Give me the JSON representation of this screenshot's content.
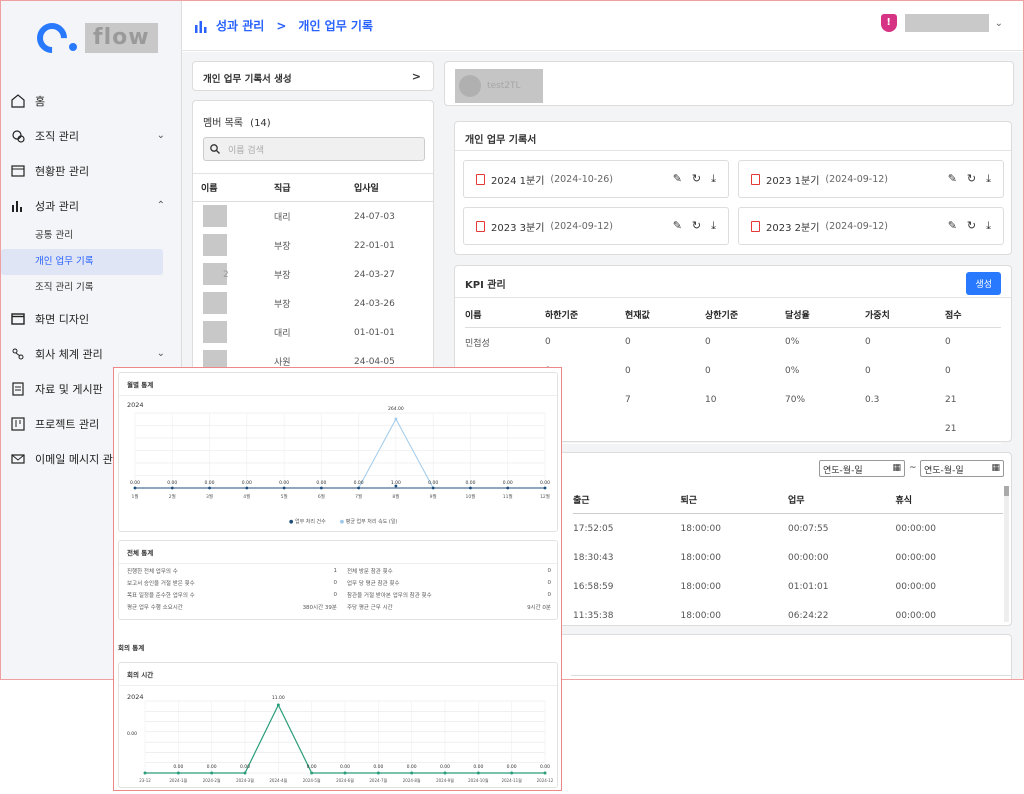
{
  "app": {
    "logo_text": "flow"
  },
  "sidebar": {
    "items": [
      {
        "label": "홈",
        "icon": "home-icon",
        "chevron": ""
      },
      {
        "label": "조직 관리",
        "icon": "org-icon",
        "chevron": "⌄"
      },
      {
        "label": "현황판 관리",
        "icon": "dashboard-icon",
        "chevron": ""
      },
      {
        "label": "성과 관리",
        "icon": "chart-icon",
        "chevron": "⌃"
      }
    ],
    "sub_items": [
      "공통 관리",
      "개인 업무 기록",
      "조직 관리 기록"
    ],
    "items2": [
      {
        "label": "화면 디자인",
        "icon": "window-icon",
        "chevron": ""
      },
      {
        "label": "회사 체계 관리",
        "icon": "hierarchy-icon",
        "chevron": "⌄"
      },
      {
        "label": "자료 및 게시판",
        "icon": "board-icon",
        "chevron": ""
      },
      {
        "label": "프로젝트 관리",
        "icon": "kanban-icon",
        "chevron": ""
      },
      {
        "label": "이메일 메시지 관리",
        "icon": "mail-icon",
        "chevron": ""
      }
    ]
  },
  "topbar": {
    "crumb1": "성과 관리",
    "sep": ">",
    "crumb2": "개인 업무 기록"
  },
  "left_panel": {
    "create_label": "개인 업무 기록서 생성",
    "create_arrow": ">",
    "members_title": "멤버 목록",
    "members_count": "(14)",
    "search_placeholder": "이름 검색",
    "headers": [
      "이름",
      "직급",
      "입사일"
    ],
    "rows": [
      {
        "name": "",
        "rank": "대리",
        "date": "24-07-03"
      },
      {
        "name": "",
        "rank": "부장",
        "date": "22-01-01"
      },
      {
        "name": "2",
        "rank": "부장",
        "date": "24-03-27"
      },
      {
        "name": "",
        "rank": "부장",
        "date": "24-03-26"
      },
      {
        "name": "",
        "rank": "대리",
        "date": "01-01-01"
      },
      {
        "name": "",
        "rank": "사원",
        "date": "24-04-05"
      }
    ]
  },
  "user_card": {
    "name": "test2TL"
  },
  "records": {
    "title": "개인 업무 기록서",
    "docs": [
      {
        "label": "2024 1분기",
        "date": "(2024-10-26)"
      },
      {
        "label": "2023 1분기",
        "date": "(2024-09-12)"
      },
      {
        "label": "2023 3분기",
        "date": "(2024-09-12)"
      },
      {
        "label": "2023 2분기",
        "date": "(2024-09-12)"
      }
    ]
  },
  "kpi": {
    "title": "KPI 관리",
    "create_label": "생성",
    "headers": [
      "이름",
      "하한기준",
      "현재값",
      "상한기준",
      "달성율",
      "가중치",
      "점수"
    ],
    "rows": [
      [
        "민첩성",
        "0",
        "0",
        "0",
        "0%",
        "0",
        "0"
      ],
      [
        "",
        "0",
        "0",
        "0",
        "0%",
        "0",
        "0"
      ],
      [
        "",
        "",
        "7",
        "10",
        "70%",
        "0.3",
        "21"
      ],
      [
        "",
        "",
        "",
        "",
        "",
        "",
        "21"
      ]
    ]
  },
  "attendance": {
    "date_placeholder": "연도-월-일",
    "tilde": "~",
    "headers": [
      "출근",
      "퇴근",
      "업무",
      "휴식"
    ],
    "rows": [
      [
        "17:52:05",
        "18:00:00",
        "00:07:55",
        "00:00:00"
      ],
      [
        "18:30:43",
        "18:00:00",
        "00:00:00",
        "00:00:00"
      ],
      [
        "16:58:59",
        "18:00:00",
        "01:01:01",
        "00:00:00"
      ],
      [
        "11:35:38",
        "18:00:00",
        "06:24:22",
        "00:00:00"
      ]
    ]
  },
  "overlay": {
    "monthly_title": "월별 통계",
    "year": "2024",
    "legend1": "업무 처리 건수",
    "legend2": "평균 업무 처리 속도 (일)",
    "total_title": "전체 통계",
    "stats_left": [
      {
        "label": "진행한 전체 업무의 수",
        "value": "1"
      },
      {
        "label": "보고서 승인을 거절 받은 횟수",
        "value": "0"
      },
      {
        "label": "목표 일정을 준수한 업무의 수",
        "value": "0"
      },
      {
        "label": "평균 업무 수행 소요시간",
        "value": "380시간 39분"
      }
    ],
    "stats_right": [
      {
        "label": "전체 방문 참관 횟수",
        "value": "0"
      },
      {
        "label": "업무 당 평균 참관 횟수",
        "value": "0"
      },
      {
        "label": "참관을 거절 받아본 업무의 참관 횟수",
        "value": "0"
      },
      {
        "label": "주당 평균 근무 시간",
        "value": "9시간 0분"
      }
    ],
    "meeting_section": "회의 통계",
    "meeting_title": "회의 시간",
    "meeting_year": "2024"
  },
  "chart_data": [
    {
      "type": "line",
      "title": "월별 통계",
      "categories": [
        "1월",
        "2월",
        "3월",
        "4월",
        "5월",
        "6월",
        "7월",
        "8월",
        "9월",
        "10월",
        "11월",
        "12월"
      ],
      "series": [
        {
          "name": "업무 처리 건수",
          "values": [
            0,
            0,
            0,
            0,
            0,
            0,
            0,
            1,
            0,
            0,
            0,
            0
          ],
          "color": "#1f4e79"
        },
        {
          "name": "평균 업무 처리 속도 (일)",
          "values": [
            0,
            0,
            0,
            0,
            0,
            0,
            0,
            264,
            0,
            0,
            0,
            0
          ],
          "color": "#9ec9ea"
        }
      ],
      "labels": [
        "0.00",
        "0.00",
        "0.00",
        "0.00",
        "0.00",
        "0.00",
        "0.00",
        "264.00",
        "0.00",
        "0.00",
        "0.00",
        "0.00"
      ],
      "label2": [
        "",
        "",
        "",
        "",
        "",
        "",
        "",
        "1.00",
        "",
        "",
        "",
        ""
      ]
    },
    {
      "type": "line",
      "title": "회의 시간",
      "categories": [
        "23-12",
        "2024-1월",
        "2024-2월",
        "2024-3월",
        "2024-4월",
        "2024-5월",
        "2024-6월",
        "2024-7월",
        "2024-8월",
        "2024-9월",
        "2024-10월",
        "2024-11월",
        "2024-12"
      ],
      "series": [
        {
          "name": "회의 시간",
          "values": [
            0,
            0,
            0,
            0,
            11,
            0,
            0,
            0,
            0,
            0,
            0,
            0,
            0
          ],
          "color": "#2a9d7a"
        }
      ],
      "labels": [
        "",
        "0.00",
        "0.00",
        "0.00",
        "11.00",
        "0.00",
        "0.00",
        "0.00",
        "0.00",
        "0.00",
        "0.00",
        "0.00",
        "0.00"
      ],
      "side_label": "0.00"
    }
  ]
}
